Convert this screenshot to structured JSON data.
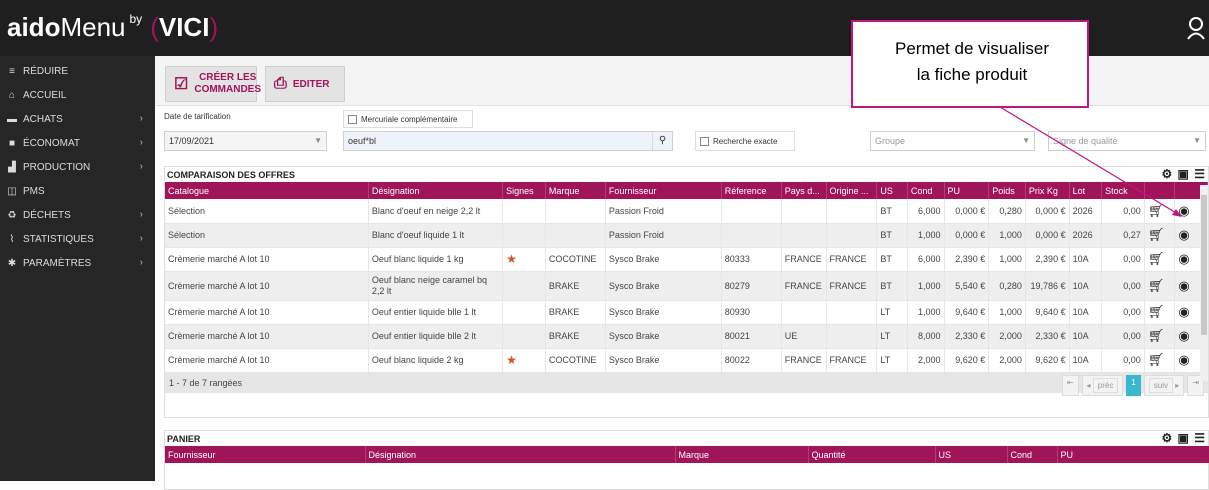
{
  "app": {
    "logo_bold": "aido",
    "logo_light": "Menu",
    "logo_sub": "by",
    "brand": "VICI"
  },
  "sidebar": {
    "items": [
      {
        "label": "RÉDUIRE",
        "icon": "hamburger-icon",
        "chevron": false
      },
      {
        "label": "ACCUEIL",
        "icon": "home-icon",
        "chevron": false
      },
      {
        "label": "ACHATS",
        "icon": "cart-icon",
        "chevron": true
      },
      {
        "label": "ÉCONOMAT",
        "icon": "truck-icon",
        "chevron": true
      },
      {
        "label": "PRODUCTION",
        "icon": "factory-icon",
        "chevron": true
      },
      {
        "label": "PMS",
        "icon": "pms-icon",
        "chevron": false
      },
      {
        "label": "DÉCHETS",
        "icon": "recycle-icon",
        "chevron": true
      },
      {
        "label": "STATISTIQUES",
        "icon": "chart-icon",
        "chevron": true
      },
      {
        "label": "PARAMÈTRES",
        "icon": "gear-icon",
        "chevron": true
      }
    ]
  },
  "toolbar": {
    "creer_line1": "CRÉER LES",
    "creer_line2": "COMMANDES",
    "editer": "EDITER"
  },
  "filters": {
    "date_label": "Date de tarification",
    "date_value": "17/09/2021",
    "mercuriale_label": "Mercuriale complémentaire",
    "search_value": "oeuf*bl",
    "recherche_exacte": "Recherche exacte",
    "groupe_placeholder": "Groupe",
    "signe_placeholder": "Signe de qualité"
  },
  "comparaison": {
    "title": "COMPARAISON DES OFFRES",
    "columns": [
      "Catalogue",
      "Désignation",
      "Signes",
      "Marque",
      "Fournisseur",
      "Réference",
      "Pays d...",
      "Origine ...",
      "US",
      "Cond",
      "PU",
      "Poids",
      "Prix Kg",
      "Lot",
      "Stock",
      "",
      ""
    ],
    "rows": [
      [
        "Sélection",
        "Blanc d'oeuf en neige 2,2 lt",
        "",
        "",
        "Passion Froid",
        "",
        "",
        "",
        "BT",
        "6,000",
        "0,000 €",
        "0,280",
        "0,000 €",
        "2026",
        "0,00"
      ],
      [
        "Sélection",
        "Blanc d'oeuf liquide 1 lt",
        "",
        "",
        "Passion Froid",
        "",
        "",
        "",
        "BT",
        "1,000",
        "0,000 €",
        "1,000",
        "0,000 €",
        "2026",
        "0,27"
      ],
      [
        "Crèmerie marché A lot 10",
        "Oeuf blanc liquide 1 kg",
        "star",
        "COCOTINE",
        "Sysco Brake",
        "80333",
        "FRANCE",
        "FRANCE",
        "BT",
        "6,000",
        "2,390 €",
        "1,000",
        "2,390 €",
        "10A",
        "0,00"
      ],
      [
        "Crèmerie marché A lot 10",
        "Oeuf blanc neige caramel bq 2,2 lt",
        "",
        "BRAKE",
        "Sysco Brake",
        "80279",
        "FRANCE",
        "FRANCE",
        "BT",
        "1,000",
        "5,540 €",
        "0,280",
        "19,786 €",
        "10A",
        "0,00"
      ],
      [
        "Crèmerie marché A lot 10",
        "Oeuf entier liquide blle 1 lt",
        "",
        "BRAKE",
        "Sysco Brake",
        "80930",
        "",
        "",
        "LT",
        "1,000",
        "9,640 €",
        "1,000",
        "9,640 €",
        "10A",
        "0,00"
      ],
      [
        "Crèmerie marché A lot 10",
        "Oeuf entier liquide blle 2 lt",
        "",
        "BRAKE",
        "Sysco Brake",
        "80021",
        "UE",
        "",
        "LT",
        "8,000",
        "2,330 €",
        "2,000",
        "2,330 €",
        "10A",
        "0,00"
      ],
      [
        "Crèmerie marché A lot 10",
        "Oeuf blanc liquide 2 kg",
        "star",
        "COCOTINE",
        "Sysco Brake",
        "80022",
        "FRANCE",
        "FRANCE",
        "LT",
        "2,000",
        "9,620 €",
        "2,000",
        "9,620 €",
        "10A",
        "0,00"
      ]
    ],
    "pager_text": "1 - 7 de 7 rangées",
    "pager_prev": "préc",
    "pager_page": "1",
    "pager_next": "suiv"
  },
  "panier": {
    "title": "PANIER",
    "columns": [
      "Fournisseur",
      "Désignation",
      "Marque",
      "Quantité",
      "US",
      "Cond",
      "PU"
    ]
  },
  "callout": {
    "line1": "Permet de visualiser",
    "line2": "la fiche produit"
  },
  "colors": {
    "accent": "#a0145a",
    "callout_border": "#c01583",
    "sidebar_bg": "#262626",
    "topbar_bg": "#1f1f1f"
  }
}
